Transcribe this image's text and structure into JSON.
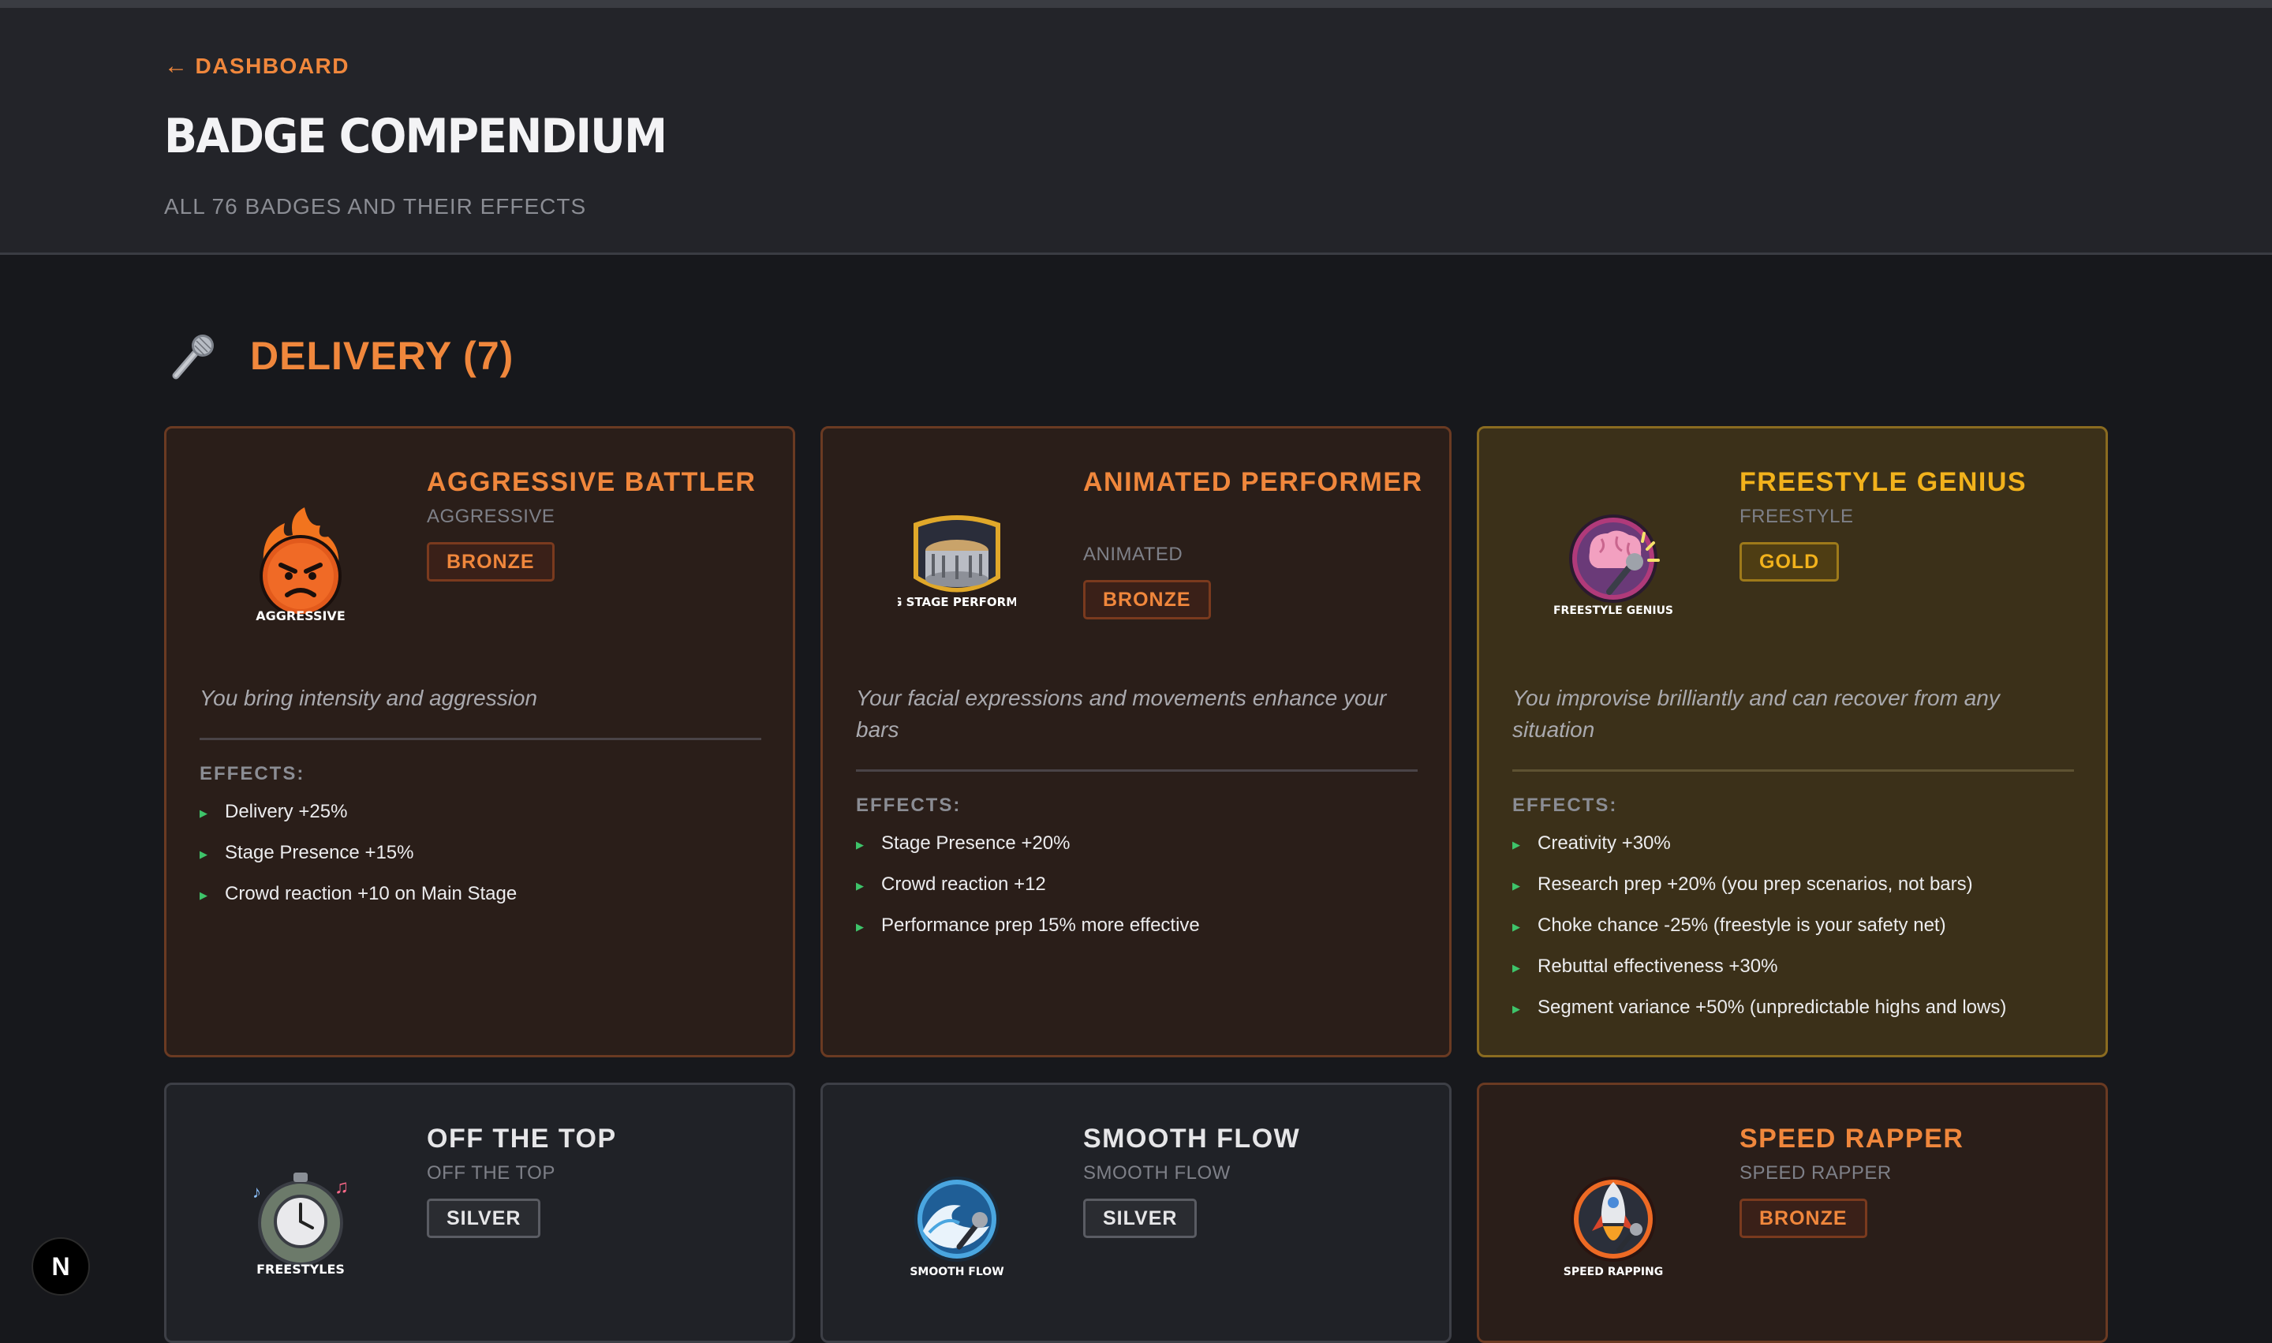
{
  "header": {
    "back_label": "DASHBOARD",
    "title": "BADGE COMPENDIUM",
    "subtitle": "ALL 76 BADGES AND THEIR EFFECTS"
  },
  "section": {
    "icon": "microphone-icon",
    "title": "DELIVERY (7)"
  },
  "badges": [
    {
      "name": "AGGRESSIVE BATTLER",
      "key": "AGGRESSIVE",
      "tier": "BRONZE",
      "icon_caption": "AGGRESSIVE",
      "description": "You bring intensity and aggression",
      "effects_label": "EFFECTS:",
      "effects": [
        "Delivery +25%",
        "Stage Presence +15%",
        "Crowd reaction +10 on Main Stage"
      ]
    },
    {
      "name": "ANIMATED PERFORMER",
      "key": "ANIMATED",
      "tier": "BRONZE",
      "icon_caption": "BIG STAGE PERFORMER",
      "description": "Your facial expressions and movements enhance your bars",
      "effects_label": "EFFECTS:",
      "effects": [
        "Stage Presence +20%",
        "Crowd reaction +12",
        "Performance prep 15% more effective"
      ]
    },
    {
      "name": "FREESTYLE GENIUS",
      "key": "FREESTYLE",
      "tier": "GOLD",
      "icon_caption": "FREESTYLE GENIUS",
      "description": "You improvise brilliantly and can recover from any situation",
      "effects_label": "EFFECTS:",
      "effects": [
        "Creativity +30%",
        "Research prep +20% (you prep scenarios, not bars)",
        "Choke chance -25% (freestyle is your safety net)",
        "Rebuttal effectiveness +30%",
        "Segment variance +50% (unpredictable highs and lows)"
      ]
    },
    {
      "name": "OFF THE TOP",
      "key": "OFF THE TOP",
      "tier": "SILVER",
      "icon_caption": "FREESTYLES"
    },
    {
      "name": "SMOOTH FLOW",
      "key": "SMOOTH FLOW",
      "tier": "SILVER",
      "icon_caption": "SMOOTH FLOW"
    },
    {
      "name": "SPEED RAPPER",
      "key": "SPEED RAPPER",
      "tier": "BRONZE",
      "icon_caption": "SPEED RAPPING"
    }
  ],
  "dev_badge_letter": "N"
}
